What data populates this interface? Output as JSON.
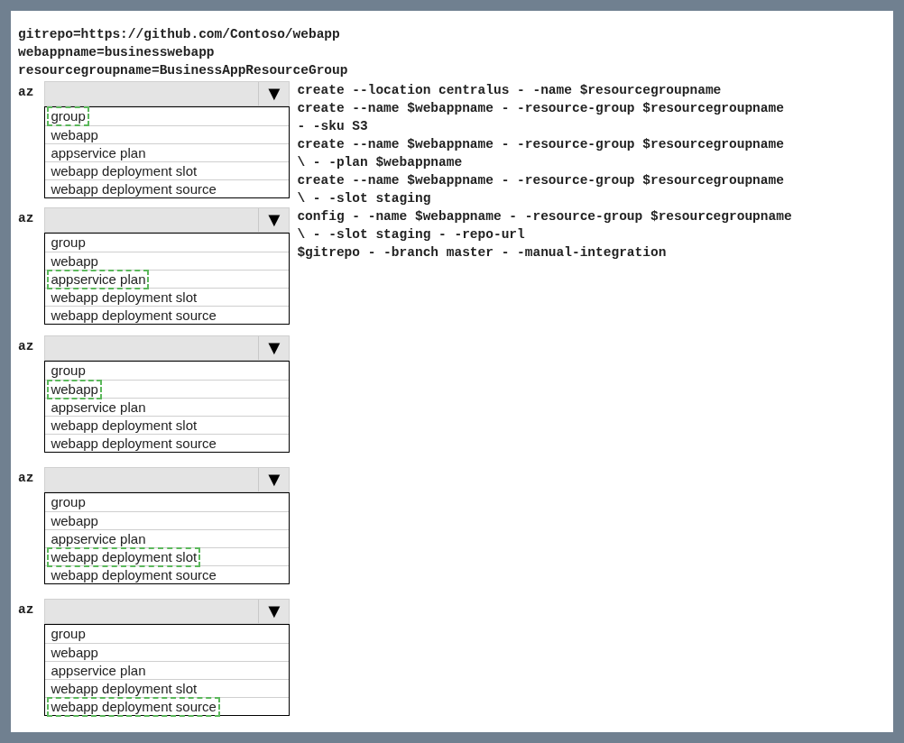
{
  "variables": [
    "gitrepo=https://github.com/Contoso/webapp",
    "webappname=businesswebapp",
    "resourcegroupname=BusinessAppResourceGroup"
  ],
  "dropdowns": [
    {
      "prefix": "az",
      "options": [
        {
          "label": "group",
          "selected": true
        },
        {
          "label": "webapp",
          "selected": false
        },
        {
          "label": "appservice plan",
          "selected": false
        },
        {
          "label": "webapp deployment slot",
          "selected": false
        },
        {
          "label": "webapp deployment source",
          "selected": false
        }
      ]
    },
    {
      "prefix": "az",
      "options": [
        {
          "label": "group",
          "selected": false
        },
        {
          "label": "webapp",
          "selected": false
        },
        {
          "label": "appservice plan",
          "selected": true
        },
        {
          "label": "webapp deployment slot",
          "selected": false
        },
        {
          "label": "webapp deployment source",
          "selected": false
        }
      ]
    },
    {
      "prefix": "az",
      "options": [
        {
          "label": "group",
          "selected": false
        },
        {
          "label": "webapp",
          "selected": true
        },
        {
          "label": "appservice plan",
          "selected": false
        },
        {
          "label": "webapp deployment slot",
          "selected": false
        },
        {
          "label": "webapp deployment source",
          "selected": false
        }
      ]
    },
    {
      "prefix": "az",
      "options": [
        {
          "label": "group",
          "selected": false
        },
        {
          "label": "webapp",
          "selected": false
        },
        {
          "label": "appservice plan",
          "selected": false
        },
        {
          "label": "webapp deployment slot",
          "selected": true
        },
        {
          "label": "webapp deployment source",
          "selected": false
        }
      ]
    },
    {
      "prefix": "az",
      "options": [
        {
          "label": "group",
          "selected": false
        },
        {
          "label": "webapp",
          "selected": false
        },
        {
          "label": "appservice plan",
          "selected": false
        },
        {
          "label": "webapp deployment slot",
          "selected": false
        },
        {
          "label": "webapp deployment source",
          "selected": true
        }
      ]
    }
  ],
  "dropdown_arrow": "▼",
  "commands": [
    "create --location centralus - -name $resourcegroupname",
    "create --name $webappname - -resource-group $resourcegroupname",
    "- -sku S3",
    "create --name $webappname - -resource-group $resourcegroupname",
    "\\ - -plan $webappname",
    "create --name $webappname - -resource-group $resourcegroupname",
    "\\ - -slot staging",
    "config - -name $webappname - -resource-group $resourcegroupname",
    "\\ - -slot staging - -repo-url",
    "$gitrepo - -branch master - -manual-integration"
  ]
}
